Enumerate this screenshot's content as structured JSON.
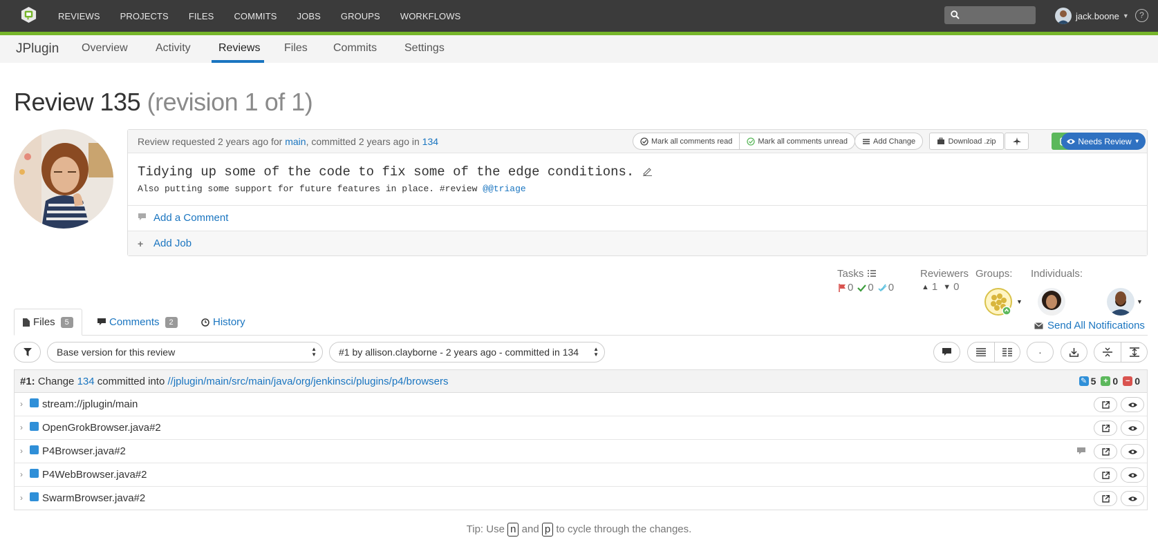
{
  "topbar": {
    "nav": [
      "REVIEWS",
      "PROJECTS",
      "FILES",
      "COMMITS",
      "JOBS",
      "GROUPS",
      "WORKFLOWS"
    ],
    "search_placeholder": "",
    "username": "jack.boone",
    "help": "?"
  },
  "project": {
    "name": "JPlugin",
    "tabs": [
      "Overview",
      "Activity",
      "Reviews",
      "Files",
      "Commits",
      "Settings"
    ],
    "active_tab": "Reviews"
  },
  "review": {
    "title": "Review 135",
    "revision": "(revision 1 of 1)",
    "requested_prefix": "Review requested 2 years ago for ",
    "stream": "main",
    "committed_text": ", committed 2 years ago in ",
    "change": "134",
    "description_line1": "Tidying up some of the code to fix some of the edge conditions.",
    "description_line2": "Also putting some support for future features in place. #review ",
    "mention": "@@triage",
    "add_comment": "Add a Comment",
    "add_job": "Add Job"
  },
  "actions": {
    "mark_read": "Mark all comments read",
    "mark_unread": "Mark all comments unread",
    "add_change": "Add Change",
    "download": "Download .zip",
    "state": "Needs Review"
  },
  "tasks": {
    "label": "Tasks",
    "open": "0",
    "addressed": "0",
    "verified": "0"
  },
  "reviewers": {
    "label": "Reviewers",
    "up": "1",
    "down": "0",
    "groups_label": "Groups:",
    "individuals_label": "Individuals:",
    "send_notifications": "Send All Notifications"
  },
  "file_tabs": [
    {
      "label": "Files",
      "count": "5"
    },
    {
      "label": "Comments",
      "count": "2"
    },
    {
      "label": "History",
      "count": ""
    }
  ],
  "controls": {
    "base_version": "Base version for this review",
    "target_version": "#1 by allison.clayborne - 2 years ago - committed in 134"
  },
  "change_header": {
    "prefix": "#1:",
    "change_word": "Change",
    "change": "134",
    "committed_into": "committed into",
    "path": "//jplugin/main/src/main/java/org/jenkinsci/plugins/p4/browsers",
    "edited": "5",
    "added": "0",
    "deleted": "0"
  },
  "files": [
    {
      "name": "stream://jplugin/main",
      "has_comments": false
    },
    {
      "name": "OpenGrokBrowser.java#2",
      "has_comments": false
    },
    {
      "name": "P4Browser.java#2",
      "has_comments": true
    },
    {
      "name": "P4WebBrowser.java#2",
      "has_comments": false
    },
    {
      "name": "SwarmBrowser.java#2",
      "has_comments": false
    }
  ],
  "tip": {
    "prefix": "Tip: Use",
    "key_next": "n",
    "and": "and",
    "key_prev": "p",
    "suffix": "to cycle through the changes."
  },
  "colors": {
    "topbar": "#3b3b3b",
    "accent_green": "#76b52a",
    "link": "#1a75c0",
    "needs_review": "#2f71c1",
    "approve": "#5cb85c"
  }
}
